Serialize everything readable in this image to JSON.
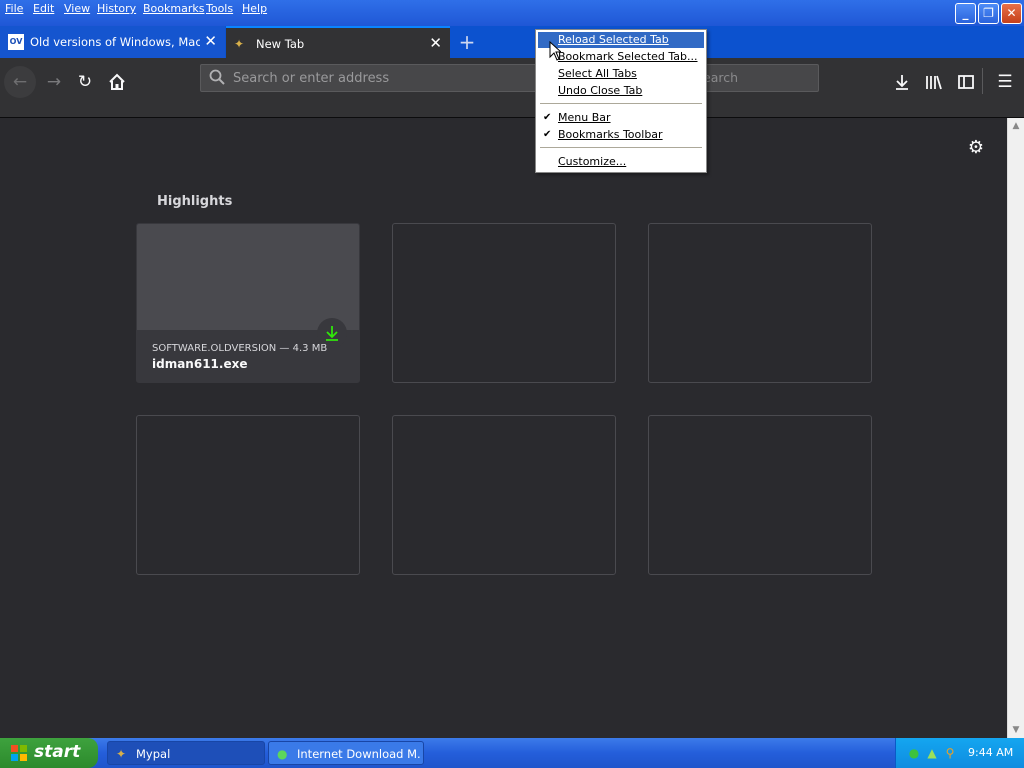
{
  "menubar": {
    "items": [
      "File",
      "Edit",
      "View",
      "History",
      "Bookmarks",
      "Tools",
      "Help"
    ]
  },
  "tabs": [
    {
      "title": "Old versions of Windows, Mac and",
      "favicon": "OV",
      "close": "✕"
    },
    {
      "title": "New Tab",
      "close": "✕"
    }
  ],
  "new_tab": "+",
  "toolbar": {
    "url_placeholder": "Search or enter address",
    "search_hint": "earch"
  },
  "highlights": {
    "title": "Highlights",
    "cards": [
      {
        "meta": "SOFTWARE.OLDVERSION — 4.3 MB",
        "name": "idman611.exe"
      }
    ]
  },
  "context_menu": {
    "items": [
      {
        "label": "Reload Selected Tab",
        "highlighted": true
      },
      {
        "label": "Bookmark Selected Tab..."
      },
      {
        "label": "Select All Tabs"
      },
      {
        "label": "Undo Close Tab"
      },
      {
        "label": "Menu Bar",
        "checked": true
      },
      {
        "label": "Bookmarks Toolbar",
        "checked": true
      },
      {
        "label": "Customize..."
      }
    ]
  },
  "taskbar": {
    "start": "start",
    "tasks": [
      {
        "label": "Mypal"
      },
      {
        "label": "Internet Download M..."
      }
    ],
    "clock": "9:44 AM"
  },
  "colors": {
    "accent": "#0a84ff",
    "menu_highlight": "#316ac5",
    "content_bg": "#2a2a2e",
    "toolbar_bg": "#323234",
    "download_green": "#30e60b"
  }
}
